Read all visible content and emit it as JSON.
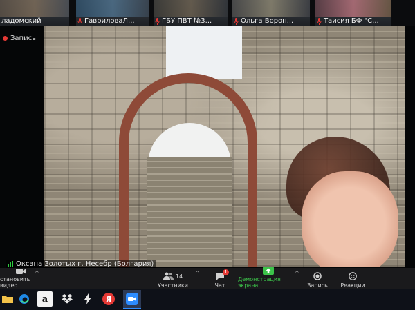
{
  "participants": [
    {
      "name": "ладомский"
    },
    {
      "name": "ГавриловаЛ..."
    },
    {
      "name": "ГБУ ПВТ №3..."
    },
    {
      "name": "Ольга Ворон..."
    },
    {
      "name": "Таисия БФ \"С..."
    }
  ],
  "recording": {
    "label": "Запись"
  },
  "speaker": {
    "name": "Оксана Золотых г. Несебр (Болгария)"
  },
  "toolbar": {
    "stop_video": "становить видео",
    "participants_label": "Участники",
    "participants_count": "14",
    "chat_label": "Чат",
    "chat_badge": "1",
    "share_label": "Демонстрация экрана",
    "record_label": "Запись",
    "reactions_label": "Реакции",
    "caret": "^"
  },
  "taskbar": {
    "amazon_letter": "a",
    "yandex_letter": "Я"
  },
  "colors": {
    "accent_green": "#3cc44a",
    "record_red": "#e53935",
    "zoom_blue": "#2d8cff"
  }
}
